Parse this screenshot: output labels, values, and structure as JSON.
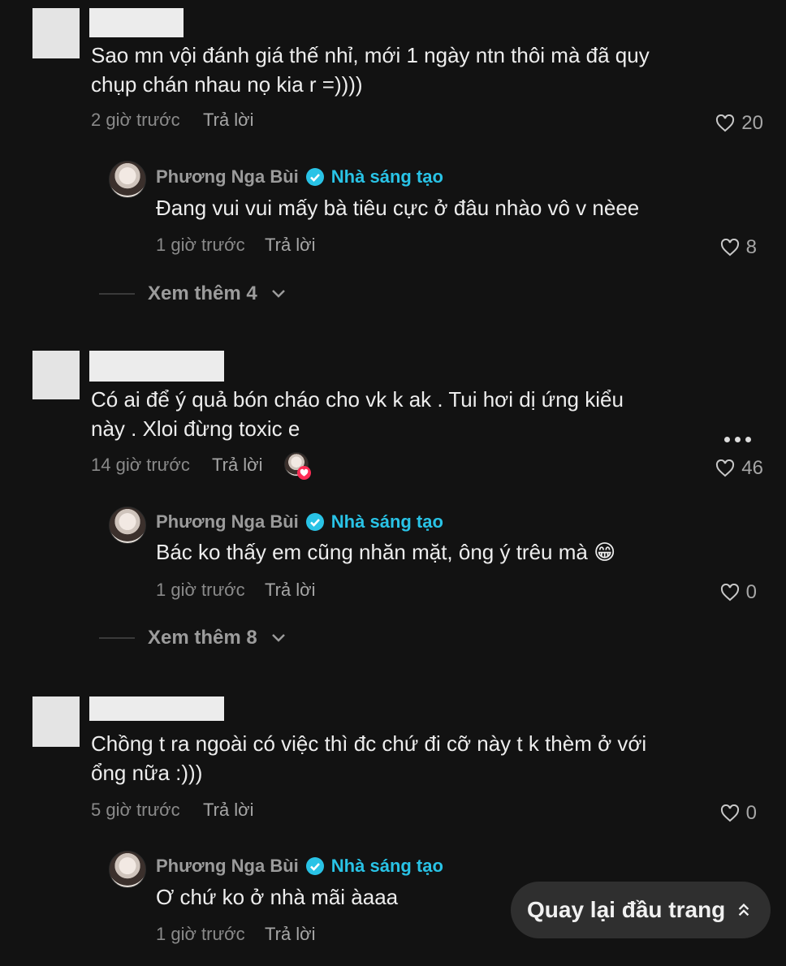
{
  "comments": [
    {
      "text_line1": "Sao mn vội đánh giá thế nhỉ, mới 1 ngày ntn thôi mà đã quy",
      "text_line2": "chụp chán nhau nọ kia r =))))",
      "time": "2 giờ trước",
      "reply_label": "Trả lời",
      "likes": "20",
      "reply": {
        "author": "Phương Nga Bùi",
        "tag": "Nhà sáng tạo",
        "text": "Đang vui vui mấy bà tiêu cực ở đâu nhào vô v nèee",
        "time": "1 giờ trước",
        "reply_label": "Trả lời",
        "likes": "8"
      },
      "more": "Xem thêm 4"
    },
    {
      "text_line1": "Có ai để ý quả bón cháo cho vk k ak . Tui hơi dị ứng kiểu",
      "text_line2": "này . Xloi đừng toxic e",
      "time": "14 giờ trước",
      "reply_label": "Trả lời",
      "likes": "46",
      "reply": {
        "author": "Phương Nga Bùi",
        "tag": "Nhà sáng tạo",
        "text": "Bác ko thấy em cũng nhăn mặt, ông ý trêu mà 😁",
        "time": "1 giờ trước",
        "reply_label": "Trả lời",
        "likes": "0"
      },
      "more": "Xem thêm 8"
    },
    {
      "text_line1": "Chồng t ra ngoài có việc thì đc chứ đi cỡ này t k thèm ở với",
      "text_line2": "ổng nữa :)))",
      "time": "5 giờ trước",
      "reply_label": "Trả lời",
      "likes": "0",
      "reply": {
        "author": "Phương Nga Bùi",
        "tag": "Nhà sáng tạo",
        "text": "Ơ chứ ko ở nhà mãi àaaa",
        "time": "1 giờ trước",
        "reply_label": "Trả lời"
      }
    }
  ],
  "back_to_top": "Quay lại đầu trang",
  "icons": {
    "like": "heart-outline-icon",
    "verified": "verified-badge-icon",
    "more": "chevron-down-icon",
    "options": "more-dots-icon",
    "back_to_top": "double-chevron-up-icon"
  },
  "colors": {
    "background": "#121212",
    "creator_tag": "#29c3e6",
    "liked_badge": "#fe2c55"
  }
}
